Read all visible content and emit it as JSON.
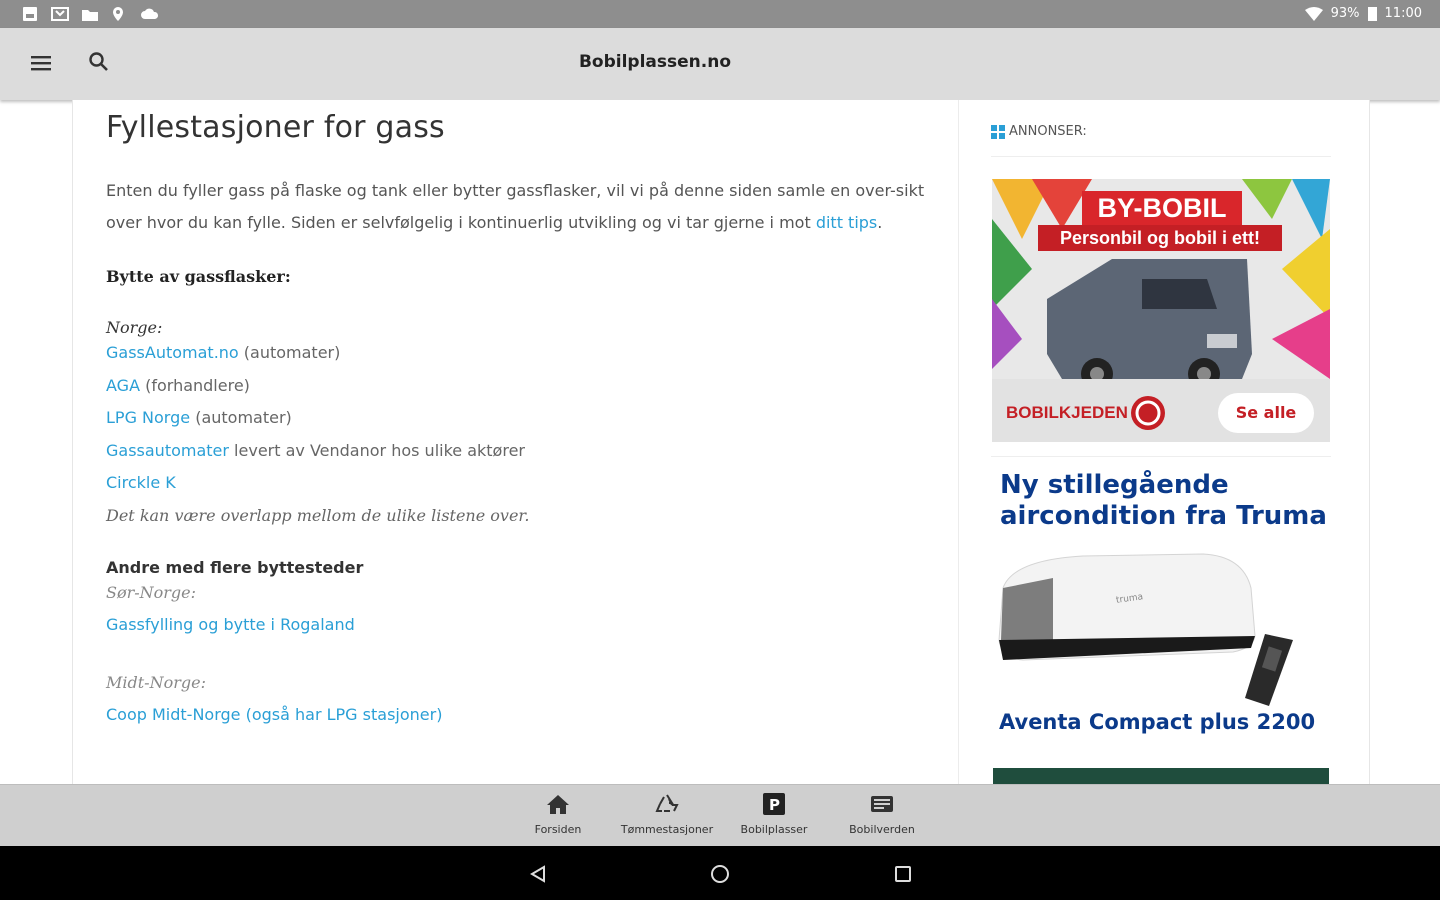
{
  "status_bar": {
    "battery": "93%",
    "time": "11:00"
  },
  "app_bar": {
    "title": "Bobilplassen.no"
  },
  "page": {
    "title": "Fyllestasjoner for gass",
    "intro_text": "Enten du fyller gass på flaske og tank eller bytter gassflasker, vil vi på denne siden samle en over-sikt over hvor du kan fylle.  Siden er selvfølgelig i kontinuerlig utvikling og vi tar gjerne i mot ",
    "intro_link": "ditt tips",
    "intro_end": ".",
    "section1": "Bytte av gassflasker:",
    "norge_label": "Norge:",
    "norge_items": [
      {
        "link": "GassAutomat.no",
        "rest": " (automater)"
      },
      {
        "link": "AGA",
        "rest": " (forhandlere)"
      },
      {
        "link": "LPG Norge",
        "rest": " (automater)"
      },
      {
        "link": "Gassautomater",
        "rest": " levert av Vendanor hos ulike aktører"
      },
      {
        "link": "Circkle K",
        "rest": ""
      }
    ],
    "overlap_note": "Det kan være overlapp mellom de ulike listene over.",
    "section2": "Andre med flere byttesteder",
    "sor_norge": "Sør-Norge:",
    "rogaland_link": "Gassfylling og bytte i Rogaland",
    "midt_norge": "Midt-Norge:",
    "cut_line": "Coop Midt-Norge (også har LPG stasjoner)"
  },
  "sidebar": {
    "ads_heading": "ANNONSER:",
    "ad1": {
      "headline": "BY-BOBIL",
      "subline": "Personbil og bobil i ett!",
      "brand": "BOBILKJEDEN",
      "cta": "Se alle"
    },
    "ad2": {
      "headline": "Ny stillegående aircondition fra Truma",
      "model": "Aventa Compact plus 2200",
      "product_brand": "truma"
    }
  },
  "bottom_nav": [
    {
      "label": "Forsiden",
      "icon": "home-icon"
    },
    {
      "label": "Tømmestasjoner",
      "icon": "recycle-icon"
    },
    {
      "label": "Bobilplasser",
      "icon": "parking-icon"
    },
    {
      "label": "Bobilverden",
      "icon": "news-icon"
    }
  ],
  "colors": {
    "link": "#2a9fd6",
    "ad_red": "#d9262b",
    "ad_blue": "#0b3a8a",
    "app_bar": "#dcdcdc",
    "status_bar": "#8e8e8e"
  }
}
